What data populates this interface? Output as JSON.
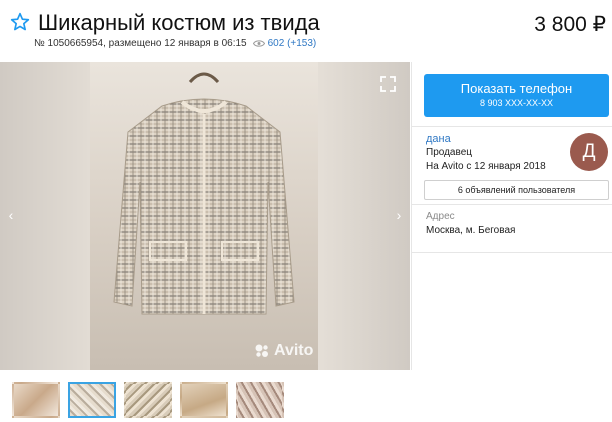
{
  "listing": {
    "title": "Шикарный костюм из твида",
    "price": "3 800 ₽",
    "number_line": "№ 1050665954, размещено 12 января в 06:15",
    "views": "602 (+153)"
  },
  "gallery": {
    "watermark": "Avito",
    "prev_arrow": "‹",
    "next_arrow": "›",
    "thumbnail_count": 5,
    "active_thumbnail": 2
  },
  "contact": {
    "phone_label": "Показать телефон",
    "phone_number": "8 903 XXX-XX-XX"
  },
  "seller": {
    "name": "дана",
    "role": "Продавец",
    "since": "На Avito с 12 января 2018",
    "avatar_letter": "Д",
    "avatar_color": "#9a5a4e",
    "listings_label": "6 объявлений пользователя"
  },
  "address": {
    "label": "Адрес",
    "value": "Москва, м. Беговая"
  },
  "colors": {
    "accent": "#1e9af0",
    "link": "#2f78c4",
    "active_thumb_border": "#3aa3e3"
  },
  "icons": [
    "star-icon",
    "eye-icon",
    "fullscreen-icon",
    "chevron-left-icon",
    "chevron-right-icon",
    "avito-logo-icon"
  ]
}
